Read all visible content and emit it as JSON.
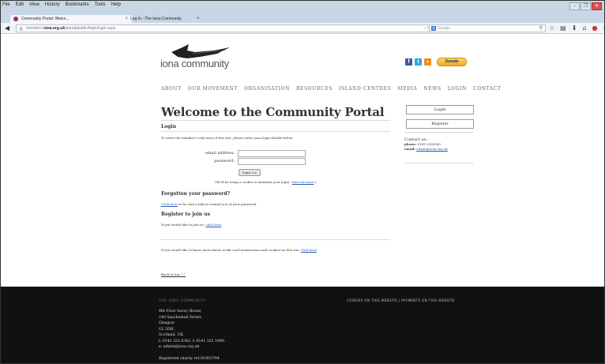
{
  "browser": {
    "menu": [
      "File",
      "Edit",
      "View",
      "History",
      "Bookmarks",
      "Tools",
      "Help"
    ],
    "tabs": [
      {
        "label": "Community Portal: Welco...",
        "close": "×"
      },
      {
        "label": "Log In - The Iona Community",
        "close": ""
      }
    ],
    "new_tab": "+",
    "url_prefix": "members.",
    "url_domain": "iona.org.uk",
    "url_path": "/portal/public/login/login.aspx",
    "url_controls": "▿ C",
    "search_placeholder": "Google",
    "window_buttons": [
      "–",
      "❐",
      "✕"
    ]
  },
  "site": {
    "logo_text": "iona community",
    "social": {
      "fb": "f",
      "tw": "t",
      "rss": "◗"
    },
    "donate_label": "Donate",
    "nav": [
      "ABOUT",
      "OUR MOVEMENT",
      "ORGANISATION",
      "RESOURCES",
      "ISLAND CENTRES",
      "MEDIA",
      "NEWS",
      "LOGIN",
      "CONTACT"
    ]
  },
  "main": {
    "title": "Welcome to the Community Portal",
    "login_heading": "Login",
    "intro": "To enter the member's only area of this site, please enter your login details below:",
    "email_label": "email address:",
    "password_label": "password:",
    "email_value": "",
    "password_value": "",
    "login_button": "login >>",
    "cookie_note_prefix": "(We'll be using a cookie to maintain your login - ",
    "cookie_note_link": "find out more",
    "cookie_note_suffix": ".)",
    "forgot_heading": "Forgotten your password?",
    "forgot_link": "Click here",
    "forgot_text": " to be sent a link to remind you of your password.",
    "register_heading": "Register to join us",
    "register_text": "If you would like to join us, ",
    "register_link": "click here",
    "register_suffix": ".",
    "cc_text": "If you would like to know more about credit card transactions and cookies on this site, ",
    "cc_link": "click here",
    "cc_suffix": ".",
    "back_to_top": "Back to top ^^"
  },
  "sidebar": {
    "login_button": "Login",
    "register_button": "Register",
    "contact_title": "Contact us:",
    "phone_label": "phone:",
    "phone_value": "0141 3326343",
    "email_label": "email:",
    "email_value": "admin@iona.org.uk"
  },
  "footer": {
    "heading": "THE IONA COMMUNITY",
    "right_links": "COOKIES ON THIS WEBSITE | PAYMENTS ON THIS WEBSITE",
    "address_lines": [
      "4th Floor Savoy House,",
      "140 Sauchiehall Street,",
      "Glasgow",
      "G2 3DH,",
      "Scotland, UK.",
      "t: 0141 332 6343. f: 0141 332 1090.",
      "e: admin@iona.org.uk"
    ],
    "charity": "Registered charity ref.SC003794"
  },
  "colors": {
    "link": "#2159b5",
    "footer_bg": "#111111",
    "donate": "#f5a623"
  }
}
